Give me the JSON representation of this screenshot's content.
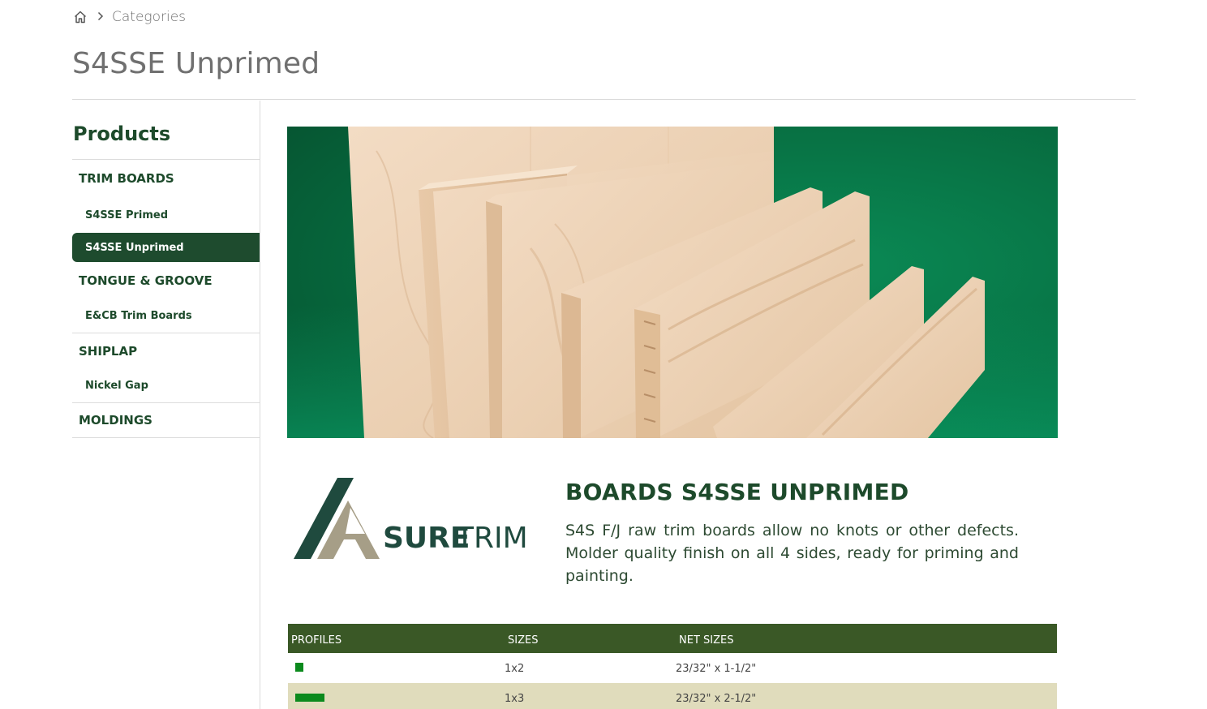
{
  "breadcrumb": {
    "home_icon": "home-icon",
    "separator_icon": "chevron-right-icon",
    "current": "Categories"
  },
  "page_title": "S4SSE Unprimed",
  "sidebar": {
    "heading": "Products",
    "items": [
      {
        "label": "TRIM BOARDS",
        "type": "category"
      },
      {
        "label": "S4SSE Primed",
        "type": "subcategory"
      },
      {
        "label": "S4SSE Unprimed",
        "type": "subcategory",
        "active": true
      },
      {
        "label": "TONGUE & GROOVE",
        "type": "category"
      },
      {
        "label": "E&CB Trim Boards",
        "type": "subcategory"
      },
      {
        "label": "SHIPLAP",
        "type": "category"
      },
      {
        "label": "Nickel Gap",
        "type": "subcategory"
      },
      {
        "label": "MOLDINGS",
        "type": "category"
      }
    ]
  },
  "logo": {
    "text_bold": "SURE",
    "text_light": "TRIM",
    "colors": {
      "dark": "#1f4a3e",
      "tan": "#a69e87"
    }
  },
  "product": {
    "heading": "BOARDS S4SSE UNPRIMED",
    "description": "S4S F/J raw trim boards allow no knots or other defects. Molder quality finish on all 4 sides, ready for priming and painting."
  },
  "table": {
    "headers": [
      "PROFILES",
      "SIZES",
      "NET SIZES"
    ],
    "rows": [
      {
        "profile_icon": "square-profile-icon",
        "size": "1x2",
        "net_size": "23/32\" x 1-1/2\""
      },
      {
        "profile_icon": "rectangle-profile-icon",
        "size": "1x3",
        "net_size": "23/32\" x 2-1/2\""
      }
    ]
  },
  "colors": {
    "brand_green": "#1d4a2b",
    "active_nav_bg": "#1e4b2e",
    "table_header_bg": "#3a5826",
    "table_alt_row_bg": "#e0dcbc",
    "profile_swatch": "#0b8a1d"
  }
}
